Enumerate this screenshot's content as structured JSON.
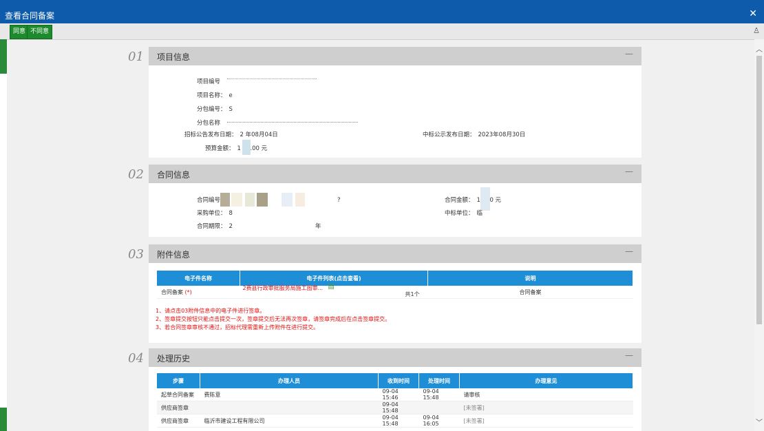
{
  "window": {
    "title": "查看合同备案"
  },
  "toolbar": {
    "agree_label": "同意",
    "disagree_label": "不同意"
  },
  "sections": {
    "s1": {
      "num": "01",
      "title": "项目信息",
      "project_no_label": "项目编号",
      "project_no_value": "",
      "project_name_label": "项目名称：",
      "project_name_value": "e",
      "package_no_label": "分包编号：",
      "package_no_value": "S",
      "package_name_label": "分包名称",
      "package_name_value": "",
      "tender_date_label": "招标公告发布日期：",
      "tender_date_value": "2    年08月04日",
      "win_date_label": "中标公示发布日期：",
      "win_date_value": "2023年08月30日",
      "budget_label": "预算金额：",
      "budget_value": "1     00.00 元"
    },
    "s2": {
      "num": "02",
      "title": "合同信息",
      "contract_no_label": "合同编号",
      "contract_no_value": "?",
      "contract_amount_label": "合同金额：",
      "contract_amount_value": "14     00 元",
      "buyer_label": "采购单位：",
      "buyer_value": "8",
      "winner_label": "中标单位：",
      "winner_value": "临",
      "term_label": "合同期限：",
      "term_value": "2",
      "term_unit": "年"
    },
    "s3": {
      "num": "03",
      "title": "附件信息",
      "headers": [
        "电子件名称",
        "电子件列表(点击查看)",
        "说明"
      ],
      "row": {
        "name": "合同备案",
        "required_mark": "(*)",
        "file": "2费县行政审批服务局施工图审...",
        "count": "共1个",
        "desc": "合同备案"
      },
      "notes": [
        "1、请点击03附件信息中的电子件进行签章。",
        "2、签章提交按钮只能点击提交一次，签章提交后无法再次签章，请签章完成后在点击签章提交。",
        "3、若合同签章审核不通过，招标代理需重新上传附件在进行提交。"
      ]
    },
    "s4": {
      "num": "04",
      "title": "处理历史",
      "headers": [
        "步骤",
        "办理人员",
        "收到时间",
        "处理时间",
        "办理意见"
      ],
      "rows": [
        {
          "step": "起草合同备案",
          "person": "费陈意",
          "recv": "09-04 15:46",
          "done": "09-04 15:48",
          "opinion": "请审核"
        },
        {
          "step": "供应商签章",
          "person": "",
          "recv": "09-04 15:48",
          "done": "",
          "opinion": "[未签署]"
        },
        {
          "step": "供应商签章",
          "person": "临沂市建设工程有限公司",
          "recv": "09-04 15:48",
          "done": "09-04 16:05",
          "opinion": "[未签署]"
        }
      ]
    }
  },
  "colors": {
    "title_bar": "#0e5aab",
    "button_green": "#1e8a2e",
    "table_header": "#1e8fd6",
    "note_red": "#e01010"
  },
  "icons": [
    "close-icon",
    "tree-icon",
    "chevron-up-icon",
    "chevron-down-icon",
    "file-icon"
  ]
}
